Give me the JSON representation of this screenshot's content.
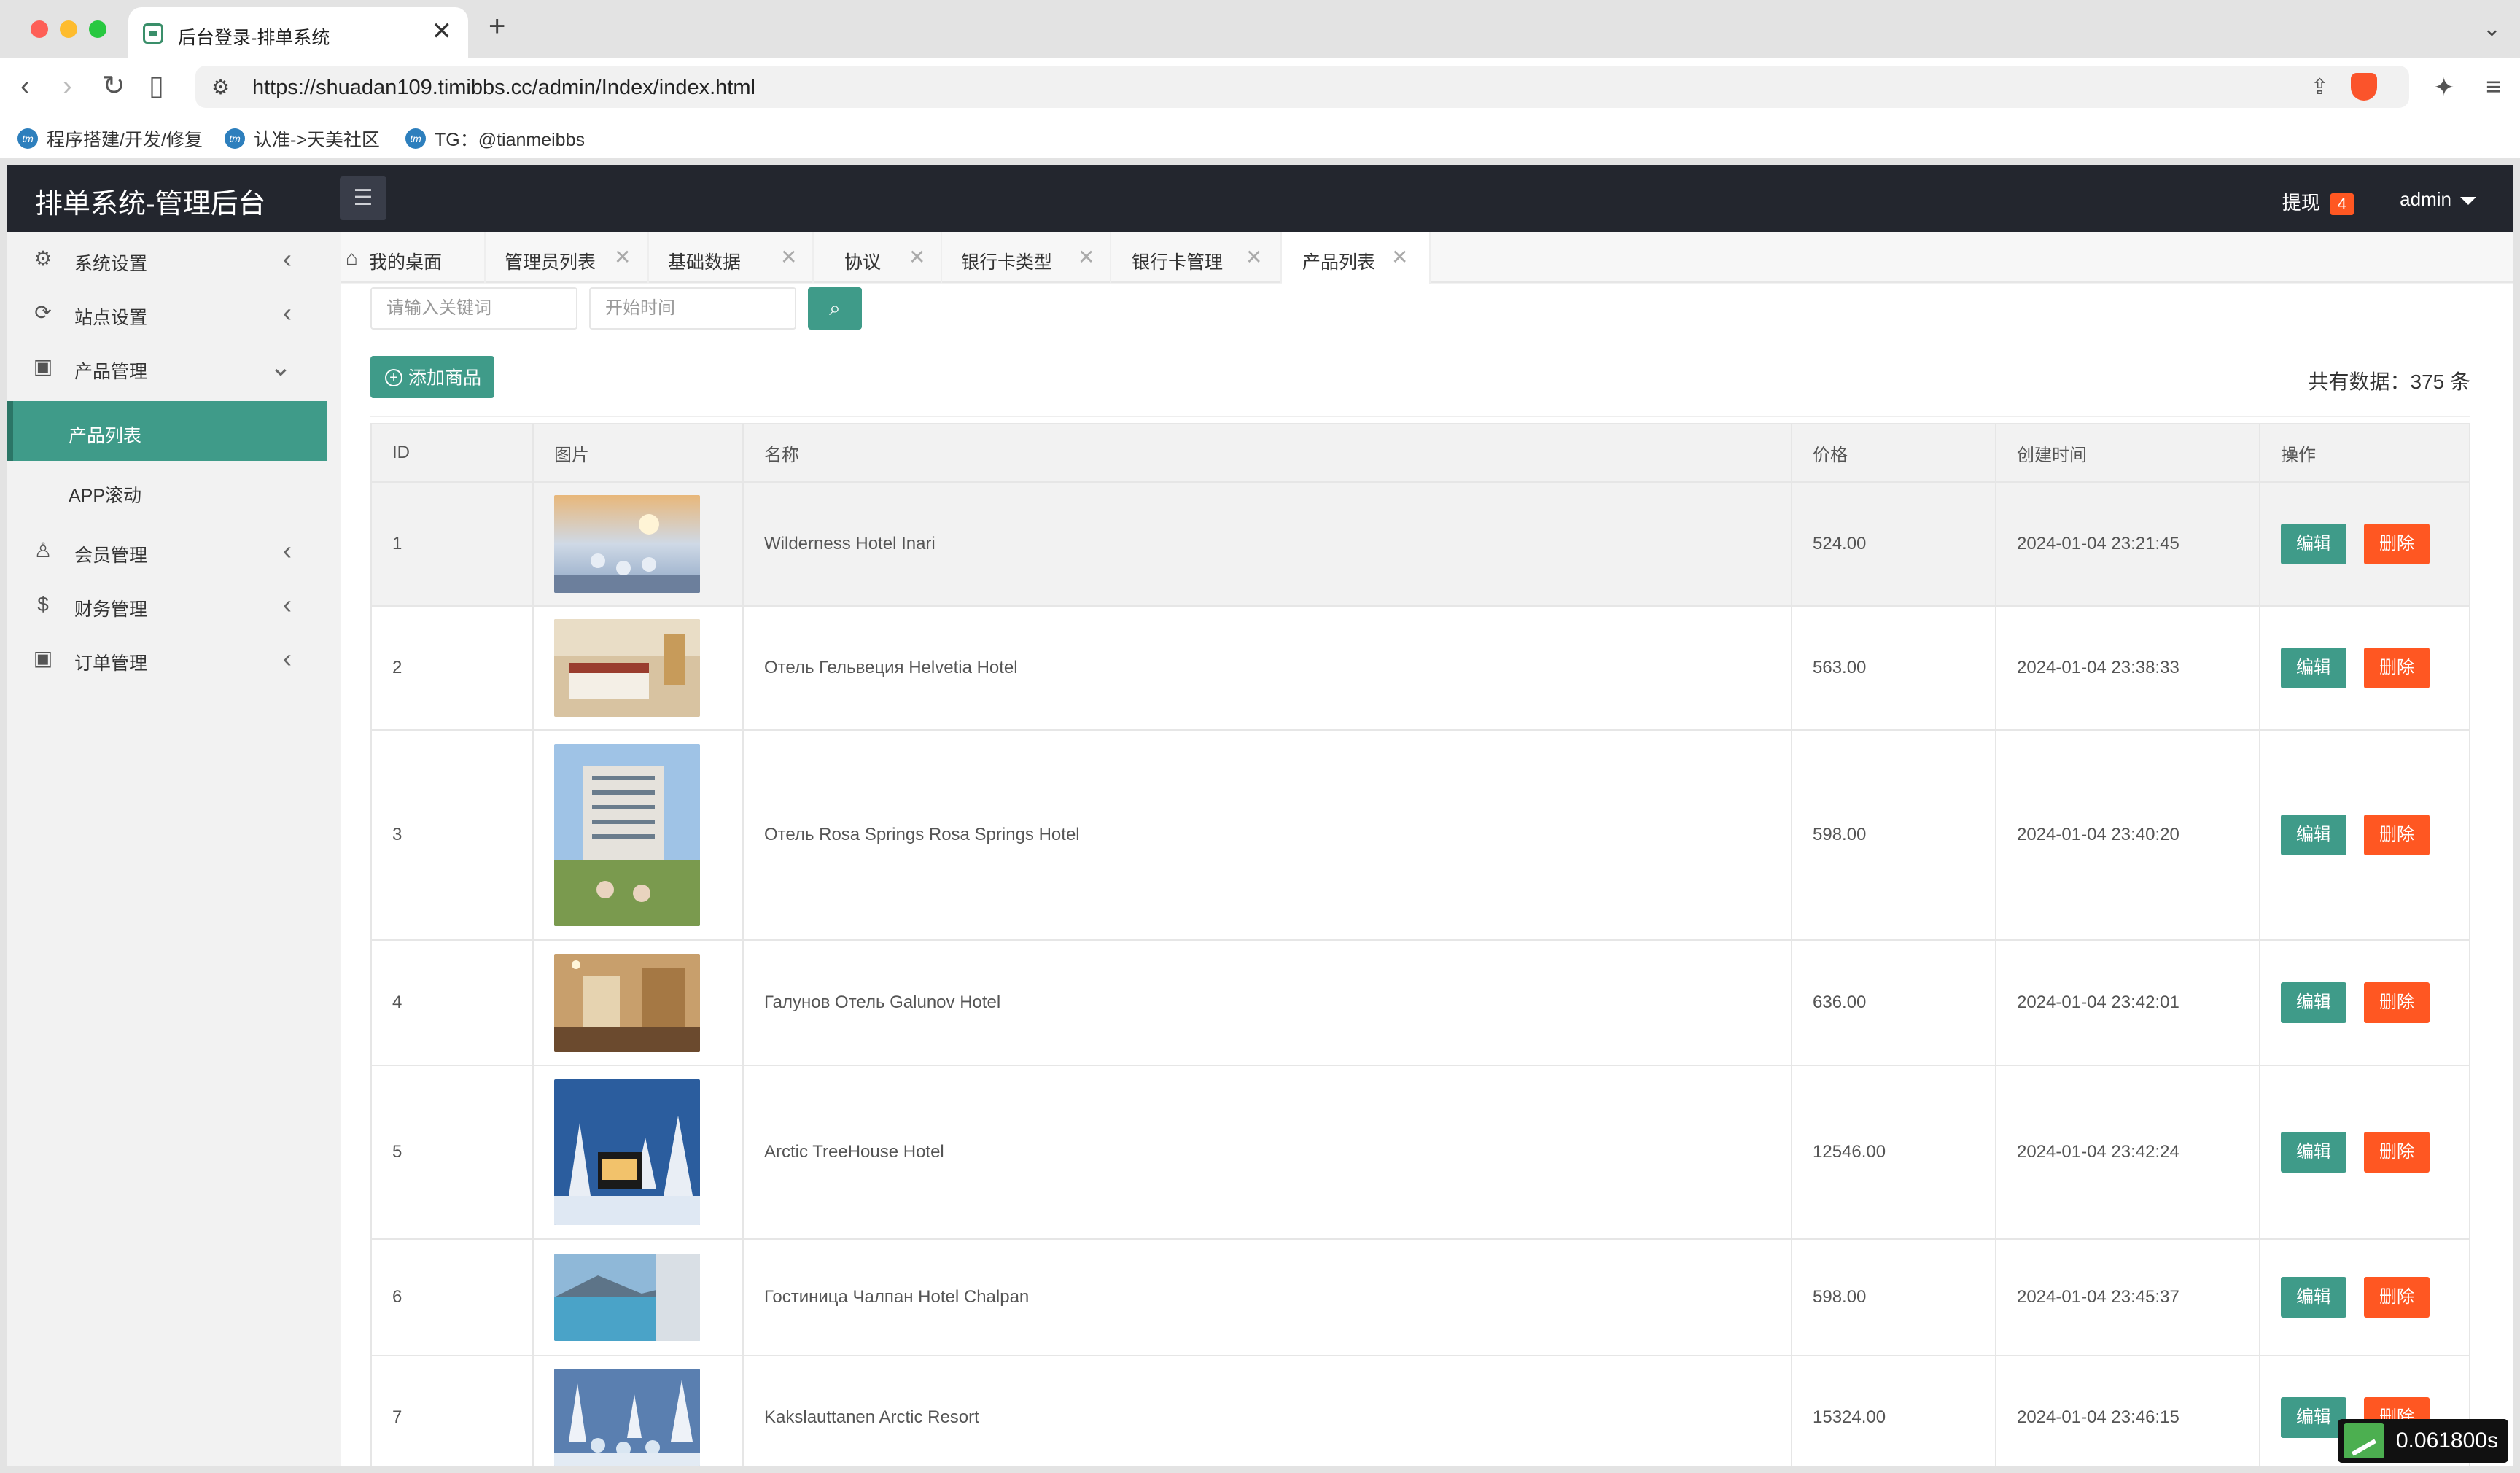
{
  "browser": {
    "tab_title": "后台登录-排单系统",
    "tab_close": "✕",
    "new_tab": "+",
    "tabs_menu": "⌄",
    "url": "https://shuadan109.timibbs.cc/admin/Index/index.html",
    "bookmarks": [
      {
        "label": "程序搭建/开发/修复",
        "icon": "tm"
      },
      {
        "label": "认准->天美社区",
        "icon": "tm"
      },
      {
        "label": "TG：@tianmeibbs",
        "icon": "tm"
      }
    ]
  },
  "header": {
    "title": "排单系统-管理后台",
    "menu_toggle_icon": "☰",
    "withdraw_label": "提现",
    "withdraw_badge": "4",
    "user": "admin"
  },
  "sidebar": {
    "items": [
      {
        "label": "系统设置",
        "icon": "gear-icon",
        "arrow": "‹"
      },
      {
        "label": "站点设置",
        "icon": "site-icon",
        "arrow": "‹"
      },
      {
        "label": "产品管理",
        "icon": "box-icon",
        "arrow": "⌄"
      },
      {
        "label": "会员管理",
        "icon": "user-icon",
        "arrow": "‹"
      },
      {
        "label": "财务管理",
        "icon": "dollar-icon",
        "arrow": "‹"
      },
      {
        "label": "订单管理",
        "icon": "box-icon",
        "arrow": "‹"
      }
    ],
    "subitems": [
      {
        "label": "产品列表",
        "active": true
      },
      {
        "label": "APP滚动",
        "active": false
      }
    ]
  },
  "page_tabs": [
    {
      "label": "我的桌面",
      "closable": false
    },
    {
      "label": "管理员列表",
      "closable": true
    },
    {
      "label": "基础数据",
      "closable": true
    },
    {
      "label": "协议",
      "closable": true
    },
    {
      "label": "银行卡类型",
      "closable": true
    },
    {
      "label": "银行卡管理",
      "closable": true
    },
    {
      "label": "产品列表",
      "closable": true,
      "active": true
    }
  ],
  "page_tab_close": "✕",
  "page_tab_home": "⌂",
  "toolbar": {
    "keyword_placeholder": "请输入关键词",
    "date_placeholder": "开始时间",
    "search_icon": "⌕",
    "add_label": "添加商品",
    "add_icon": "+",
    "total_text": "共有数据：375 条"
  },
  "table": {
    "columns": [
      "ID",
      "图片",
      "名称",
      "价格",
      "创建时间",
      "操作"
    ],
    "edit_label": "编辑",
    "delete_label": "删除",
    "rows": [
      {
        "id": "1",
        "name": "Wilderness Hotel Inari",
        "price": "524.00",
        "created": "2024-01-04 23:21:45"
      },
      {
        "id": "2",
        "name": "Отель Гельвеция Helvetia Hotel",
        "price": "563.00",
        "created": "2024-01-04 23:38:33"
      },
      {
        "id": "3",
        "name": "Отель Rosa Springs Rosa Springs Hotel",
        "price": "598.00",
        "created": "2024-01-04 23:40:20"
      },
      {
        "id": "4",
        "name": "Галунов Отель Galunov Hotel",
        "price": "636.00",
        "created": "2024-01-04 23:42:01"
      },
      {
        "id": "5",
        "name": "Arctic TreeHouse Hotel",
        "price": "12546.00",
        "created": "2024-01-04 23:42:24"
      },
      {
        "id": "6",
        "name": "Гостиница Чалпан Hotel Chalpan",
        "price": "598.00",
        "created": "2024-01-04 23:45:37"
      },
      {
        "id": "7",
        "name": "Kakslauttanen Arctic Resort",
        "price": "15324.00",
        "created": "2024-01-04 23:46:15"
      }
    ]
  },
  "timer": "0.061800s",
  "colors": {
    "accent": "#3f9b89",
    "danger": "#ff5722",
    "header_bg": "#23262e"
  }
}
